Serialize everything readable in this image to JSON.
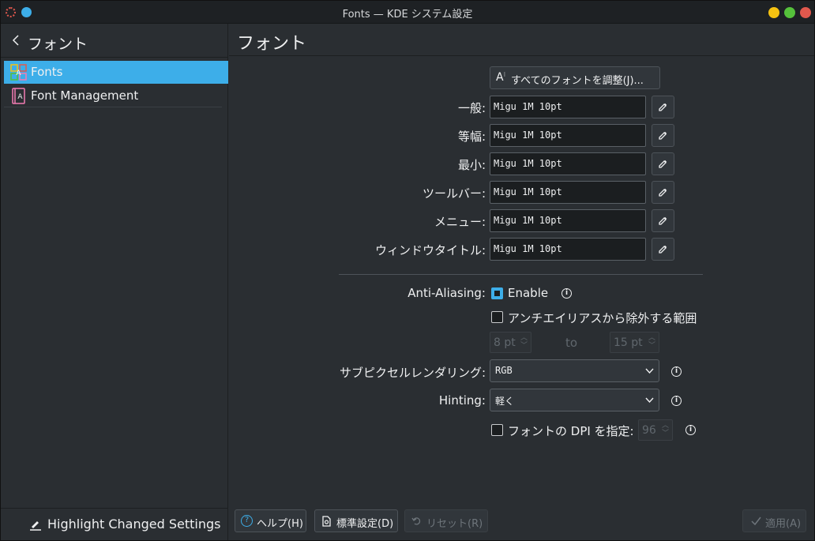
{
  "window": {
    "title": "Fonts — KDE システム設定"
  },
  "sidebar": {
    "back_title": "フォント",
    "items": [
      {
        "label": "Fonts",
        "active": true
      },
      {
        "label": "Font Management",
        "active": false
      }
    ],
    "footer_label": "Highlight Changed Settings"
  },
  "main": {
    "page_title": "フォント",
    "adjust_all_label": "すべてのフォントを調整(J)...",
    "fonts": [
      {
        "label": "一般:",
        "value": "Migu 1M 10pt"
      },
      {
        "label": "等幅:",
        "value": "Migu 1M 10pt"
      },
      {
        "label": "最小:",
        "value": "Migu 1M 10pt"
      },
      {
        "label": "ツールバー:",
        "value": "Migu 1M 10pt"
      },
      {
        "label": "メニュー:",
        "value": "Migu 1M 10pt"
      },
      {
        "label": "ウィンドウタイトル:",
        "value": "Migu 1M 10pt"
      }
    ],
    "antialiasing": {
      "label": "Anti-Aliasing:",
      "enable_label": "Enable",
      "enabled": true,
      "exclude_label": "アンチエイリアスから除外する範囲",
      "exclude_enabled": false,
      "range_from": "8 pt",
      "range_to_label": "to",
      "range_to": "15 pt"
    },
    "subpixel": {
      "label": "サブピクセルレンダリング:",
      "value": "RGB"
    },
    "hinting": {
      "label": "Hinting:",
      "value": "軽く"
    },
    "dpi": {
      "label": "フォントの DPI を指定:",
      "enabled": false,
      "value": "96"
    }
  },
  "footer": {
    "help_label": "ヘルプ(H)",
    "defaults_label": "標準設定(D)",
    "reset_label": "リセット(R)",
    "apply_label": "適用(A)"
  },
  "colors": {
    "accent": "#3daee9",
    "background": "#2a2e32",
    "field_bg": "#1b1e20"
  }
}
